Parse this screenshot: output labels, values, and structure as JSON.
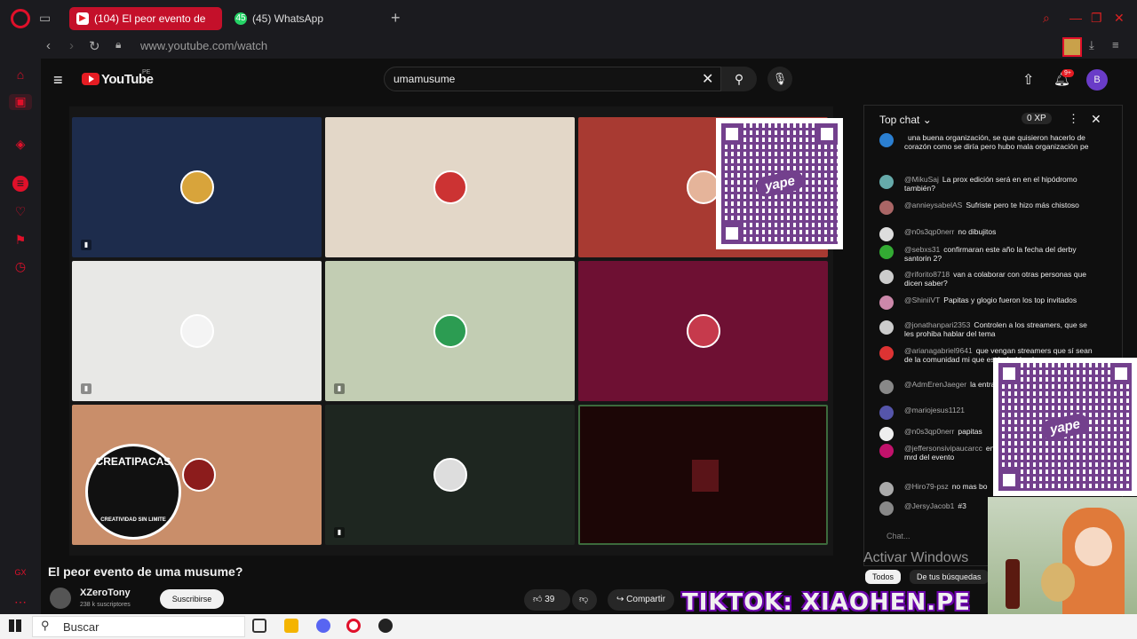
{
  "browser": {
    "tabs": [
      {
        "title": "(104) El peor evento de",
        "icon": "youtube-icon"
      },
      {
        "title": "(45) WhatsApp",
        "icon": "whatsapp-icon",
        "badge": "45"
      }
    ],
    "url": "www.youtube.com/watch"
  },
  "youtube": {
    "logo_text": "YouTube",
    "country": "PE",
    "search_value": "umamusume",
    "notifications_badge": "9+",
    "account_initial": "B"
  },
  "video": {
    "title": "El peor evento de uma musume?",
    "channel": "XZeroTony",
    "subscribers": "238 k suscriptores",
    "subscribe_label": "Suscribirse",
    "likes": "39",
    "share_label": "Compartir",
    "overlay_logo_top": "CREATIPACAS",
    "overlay_logo_bottom": "CREATIVIDAD SIN LIMITE",
    "qr_logo": "yape"
  },
  "chat": {
    "header": "Top chat",
    "xp": "0 XP",
    "input_placeholder": "Chat...",
    "messages": [
      {
        "user": "",
        "text": "una buena organización, se que quisieron hacerlo de corazón como se diría pero hubo mala organización pe"
      },
      {
        "user": "@MikuSaj",
        "text": "La prox edición será en en el hipódromo también?"
      },
      {
        "user": "@annieysabelAS",
        "text": "Sufriste pero te hizo más chistoso"
      },
      {
        "user": "@n0s3qp0nerr",
        "text": "no dibujitos"
      },
      {
        "user": "@sebxs31",
        "text": "confirmaran este año la fecha del derby santorin 2?"
      },
      {
        "user": "@riforito8718",
        "text": "van a colaborar con otras personas que dicen saber?"
      },
      {
        "user": "@ShiniiVT",
        "text": "Papitas y glogio fueron los top invitados"
      },
      {
        "user": "@jonathanpari2353",
        "text": "Controlen a los streamers, que se les prohiba hablar del tema"
      },
      {
        "user": "@arianagabriel9641",
        "text": "que vengan streamers que sí sean de la comunidad mi que están hablando"
      },
      {
        "user": "@AdmErenJaeger",
        "text": "la entrada rosada de Rexona"
      },
      {
        "user": "@mariojesus1121",
        "text": ""
      },
      {
        "user": "@n0s3qp0nerr",
        "text": "papitas"
      },
      {
        "user": "@jeffersonsivipaucarcc",
        "text": "entonces todos vana apo ni mrd del evento"
      },
      {
        "user": "@Hiro79-psz",
        "text": "no mas bo"
      },
      {
        "user": "@JersyJacob1",
        "text": "#3"
      }
    ],
    "chips": [
      "Todos",
      "De tus búsquedas"
    ]
  },
  "overlays": {
    "activate_windows": "Activar Windows",
    "tiktok": "TIKTOK: XIAOHEN.PE"
  },
  "taskbar": {
    "search_placeholder": "Buscar"
  }
}
